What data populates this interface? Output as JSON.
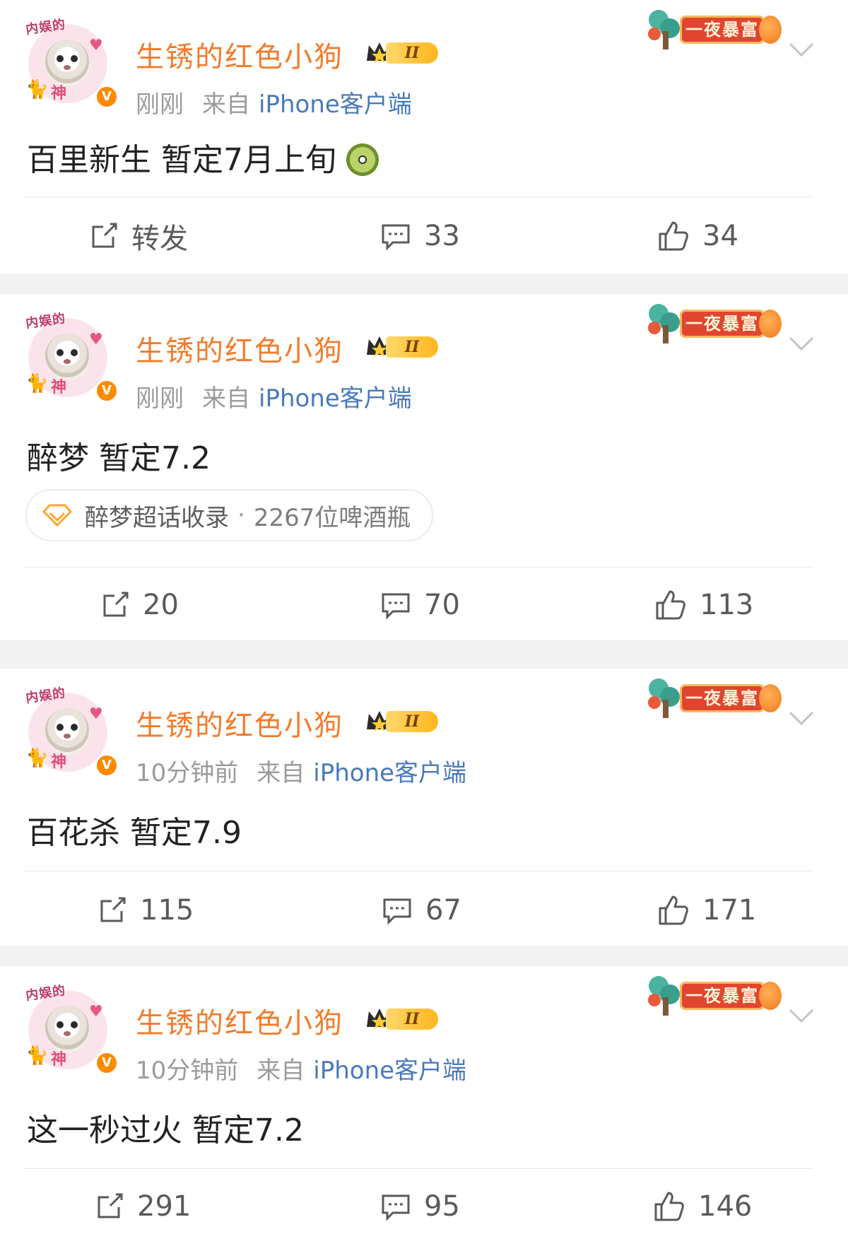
{
  "user": {
    "name": "生锈的红色小狗",
    "vip_level": "II",
    "avatar_tag_top": "内娱的",
    "avatar_tag_bottom": "神",
    "verified_mark": "V"
  },
  "banner_label": "一夜暴富",
  "colors": {
    "username": "#f47b2a",
    "client_link": "#4a79b9",
    "meta": "#9b9b9b",
    "separator": "#f2f2f2"
  },
  "posts": [
    {
      "time": "刚刚",
      "from_label": "来自",
      "client": "iPhone客户端",
      "content": "百里新生 暂定7月上旬",
      "emoji": "kiwi-emoji",
      "repost": "转发",
      "comments": "33",
      "likes": "34"
    },
    {
      "time": "刚刚",
      "from_label": "来自",
      "client": "iPhone客户端",
      "content": "醉梦 暂定7.2",
      "supertopic": {
        "label": "醉梦超话收录",
        "separator": "·",
        "count": "2267位啤酒瓶"
      },
      "repost": "20",
      "comments": "70",
      "likes": "113"
    },
    {
      "time": "10分钟前",
      "from_label": "来自",
      "client": "iPhone客户端",
      "content": "百花杀 暂定7.9",
      "repost": "115",
      "comments": "67",
      "likes": "171"
    },
    {
      "time": "10分钟前",
      "from_label": "来自",
      "client": "iPhone客户端",
      "content": "这一秒过火 暂定7.2",
      "repost": "291",
      "comments": "95",
      "likes": "146"
    }
  ],
  "icons": {
    "repost": "repost-icon",
    "comment": "comment-icon",
    "like": "thumbs-up-icon",
    "menu": "chevron-down-icon"
  }
}
